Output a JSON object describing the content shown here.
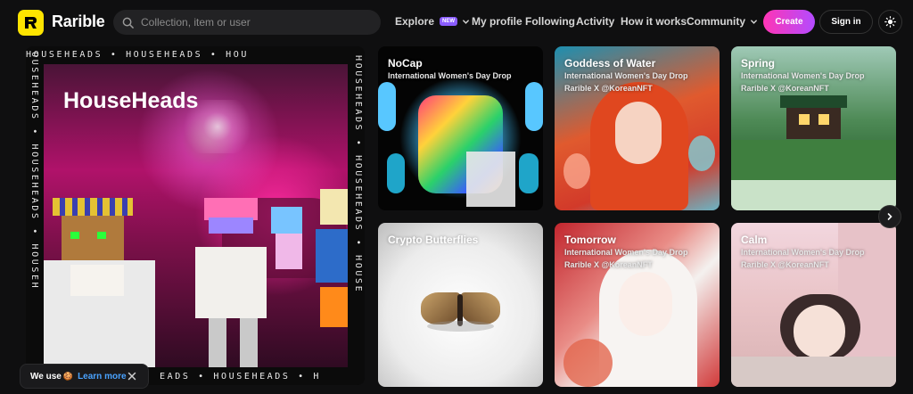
{
  "header": {
    "brand": "Rarible",
    "search_placeholder": "Collection, item or user",
    "nav": {
      "explore": "Explore",
      "explore_badge": "NEW",
      "my_profile": "My profile",
      "following": "Following",
      "activity": "Activity",
      "how_it_works": "How it works",
      "community": "Community"
    },
    "create_label": "Create",
    "signin_label": "Sign in"
  },
  "featured": {
    "title": "HouseHeads",
    "frame_text": "HOUSEHEADS • HOUSEHEADS • HOU",
    "frame_text_bottom": "EADS • HOUSEHEADS • H",
    "frame_text_side": "HOUSEHEADS • HOUSEHEADS • HOUSE",
    "frame_text_left": "OUSEHEADS • HOUSEHEADS • HOUSEH"
  },
  "cards": [
    {
      "title": "NoCap",
      "subtitle": "International Women's Day Drop",
      "subtitle2": ""
    },
    {
      "title": "Goddess of Water",
      "subtitle": "International Women's Day Drop",
      "subtitle2": "Rarible X @KoreanNFT"
    },
    {
      "title": "Spring",
      "subtitle": "International Women's Day Drop",
      "subtitle2": "Rarible X @KoreanNFT"
    },
    {
      "title": "Crypto Butterflies",
      "subtitle": "",
      "subtitle2": ""
    },
    {
      "title": "Tomorrow",
      "subtitle": "International Women's Day Drop",
      "subtitle2": "Rarible X @KoreanNFT"
    },
    {
      "title": "Calm",
      "subtitle": "International Women's Day Drop",
      "subtitle2": "Rarible X @KoreanNFT"
    }
  ],
  "cookie": {
    "text": "We use",
    "emoji": "🍪",
    "link": "Learn more"
  },
  "icons": {
    "search": "search-icon",
    "explore_chevron": "chevron-down-icon",
    "community_chevron": "chevron-down-icon",
    "theme": "sun-icon",
    "next": "chevron-right-icon",
    "cookie_close": "close-icon"
  },
  "colors": {
    "logo": "#fee400",
    "create_gradient_start": "#ff35b5",
    "create_gradient_end": "#b34bff",
    "new_badge": "#8a5cff",
    "link": "#4aa3ff"
  }
}
